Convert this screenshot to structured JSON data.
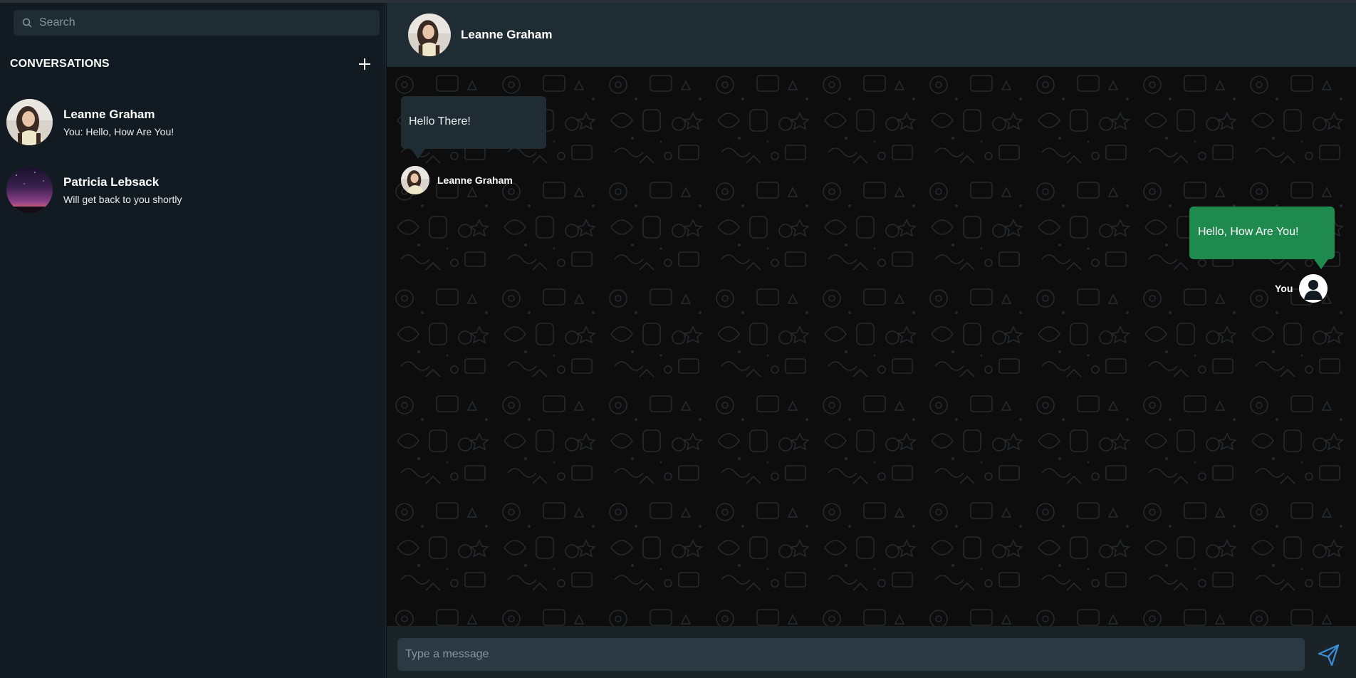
{
  "search": {
    "placeholder": "Search"
  },
  "sidebar": {
    "title": "CONVERSATIONS",
    "conversations": [
      {
        "name": "Leanne Graham",
        "last_message": "You: Hello, How Are You!"
      },
      {
        "name": "Patricia Lebsack",
        "last_message": "Will get back to you shortly"
      }
    ]
  },
  "chat": {
    "header_name": "Leanne Graham",
    "messages": [
      {
        "text": "Hello There!",
        "sender": "Leanne Graham",
        "direction": "incoming"
      },
      {
        "text": "Hello, How Are You!",
        "sender": "You",
        "direction": "outgoing"
      }
    ],
    "composer_placeholder": "Type a message"
  },
  "colors": {
    "sidebar_bg": "#111b21",
    "header_bg": "#202c33",
    "incoming_bubble": "#202c33",
    "outgoing_bubble": "#1f8a4e",
    "send_icon": "#3b8fd8"
  },
  "icons": {
    "search": "search-icon",
    "new_chat": "plus-icon",
    "send": "send-icon",
    "default_avatar": "user-icon"
  }
}
